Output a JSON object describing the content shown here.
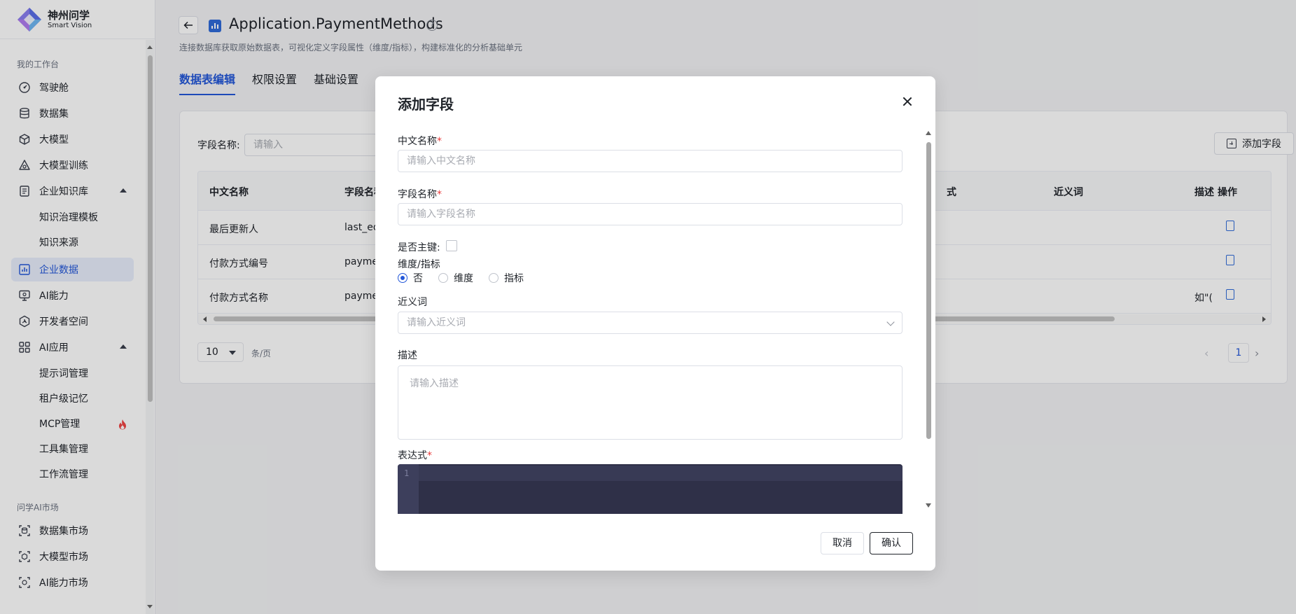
{
  "app": {
    "name_cn": "神州问学",
    "name_en": "Smart Vision"
  },
  "sidebar": {
    "section_workbench": "我的工作台",
    "items": [
      {
        "label": "驾驶舱",
        "icon": "dashboard-icon"
      },
      {
        "label": "数据集",
        "icon": "database-icon"
      },
      {
        "label": "大模型",
        "icon": "cube-icon"
      },
      {
        "label": "大模型训练",
        "icon": "training-icon"
      },
      {
        "label": "企业知识库",
        "icon": "knowledge-icon"
      },
      {
        "label": "企业数据",
        "icon": "chart-icon"
      },
      {
        "label": "AI能力",
        "icon": "monitor-icon"
      },
      {
        "label": "开发者空间",
        "icon": "dev-icon"
      },
      {
        "label": "AI应用",
        "icon": "grid-icon"
      }
    ],
    "knowledge_sub": [
      "知识治理模板",
      "知识来源"
    ],
    "ai_app_sub": [
      "提示词管理",
      "租户级记忆",
      "MCP管理",
      "工具集管理",
      "工作流管理"
    ],
    "section_market": "问学AI市场",
    "market_items": [
      {
        "label": "数据集市场",
        "icon": "dataset-market-icon"
      },
      {
        "label": "大模型市场",
        "icon": "model-market-icon"
      },
      {
        "label": "AI能力市场",
        "icon": "ai-market-icon"
      }
    ],
    "active": "企业数据"
  },
  "header": {
    "title": "Application.PaymentMethods",
    "subtitle": "连接数据库获取原始数据表，可视化定义字段属性（维度/指标），构建标准化的分析基础单元",
    "tabs": [
      "数据表编辑",
      "权限设置",
      "基础设置"
    ],
    "active_tab": "数据表编辑"
  },
  "filter": {
    "label": "字段名称:",
    "placeholder": "请输入"
  },
  "add_field_button": "添加字段",
  "table": {
    "columns": [
      "中文名称",
      "字段名称",
      "式",
      "近义词",
      "描述",
      "操作"
    ],
    "rows": [
      {
        "cn": "最后更新人",
        "field": "last_ed",
        "desc": ""
      },
      {
        "cn": "付款方式编号",
        "field": "payme",
        "desc": ""
      },
      {
        "cn": "付款方式名称",
        "field": "payme",
        "desc": "如\"("
      }
    ]
  },
  "pagination": {
    "page_size": "10",
    "per_page": "条/页",
    "current": "1"
  },
  "modal": {
    "title": "添加字段",
    "cn_name_label": "中文名称",
    "cn_name_placeholder": "请输入中文名称",
    "field_name_label": "字段名称",
    "field_name_placeholder": "请输入字段名称",
    "required_mark": "*",
    "primary_key_label": "是否主键:",
    "dim_label": "维度/指标",
    "dim_options": [
      "否",
      "维度",
      "指标"
    ],
    "dim_selected": "否",
    "synonym_label": "近义词",
    "synonym_placeholder": "请输入近义词",
    "desc_label": "描述",
    "desc_placeholder": "请输入描述",
    "expr_label": "表达式",
    "code_line": "1",
    "cancel": "取消",
    "confirm": "确认"
  },
  "colors": {
    "primary": "#2357d9",
    "active_bg": "#e8eefc",
    "required": "#e83a3a",
    "editor_bg": "#2f3048"
  }
}
